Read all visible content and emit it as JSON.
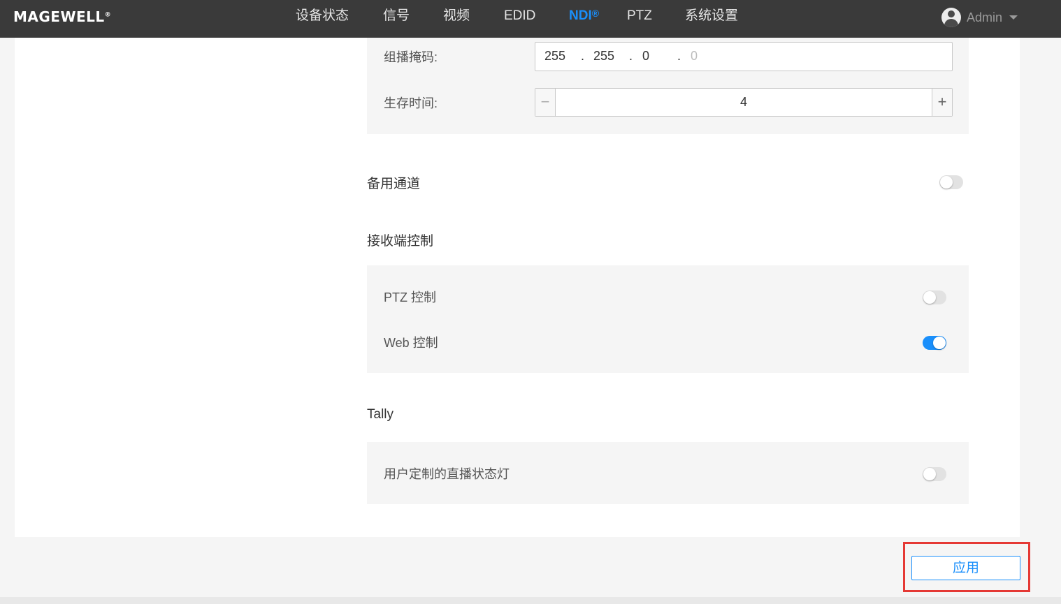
{
  "app": {
    "logo": "MAGEWELL",
    "logo_mark": "®"
  },
  "nav": {
    "items": [
      {
        "label": "设备状态"
      },
      {
        "label": "信号"
      },
      {
        "label": "视频"
      },
      {
        "label": "EDID"
      },
      {
        "label": "NDI",
        "suffix": "®",
        "active": true
      },
      {
        "label": "PTZ"
      },
      {
        "label": "系统设置"
      }
    ],
    "user": "Admin"
  },
  "multicast": {
    "mask_label": "组播掩码:",
    "mask_segments": [
      "255",
      "255",
      "0",
      "0"
    ],
    "mask_last_placeholder": true,
    "ttl_label": "生存时间:",
    "ttl_value": "4",
    "minus": "−",
    "plus": "+"
  },
  "backup_channel": {
    "label": "备用通道",
    "enabled": false
  },
  "receiver_control": {
    "title": "接收端控制",
    "ptz_label": "PTZ 控制",
    "ptz_enabled": false,
    "web_label": "Web 控制",
    "web_enabled": true
  },
  "tally": {
    "title": "Tally",
    "custom_label": "用户定制的直播状态灯",
    "custom_enabled": false
  },
  "actions": {
    "apply_label": "应用"
  },
  "colors": {
    "accent": "#1a8ffb",
    "topbar": "#3a3a3a",
    "highlight": "#e53935"
  }
}
